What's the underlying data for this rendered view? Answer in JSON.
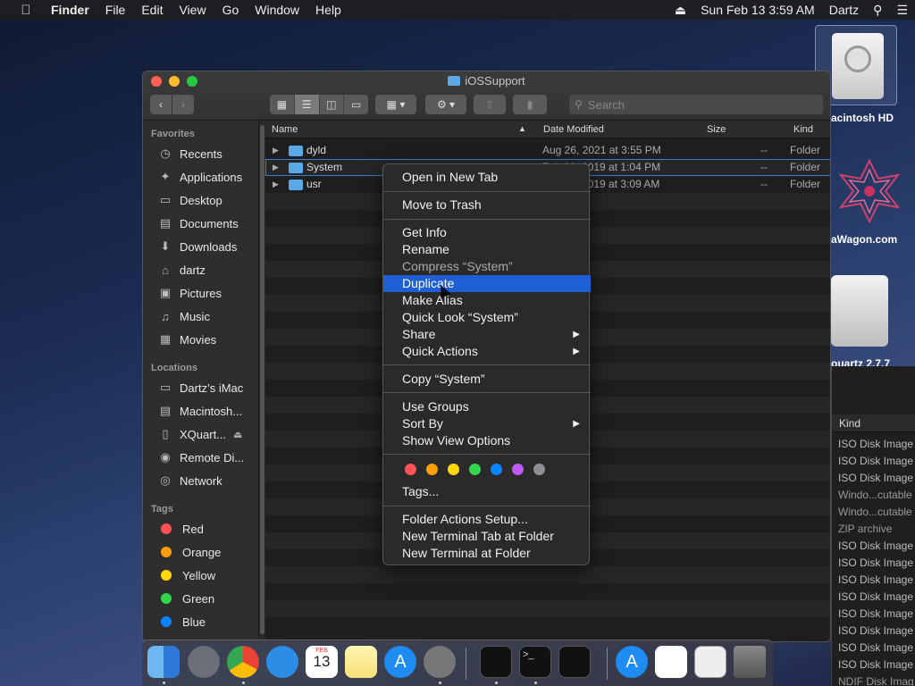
{
  "menubar": {
    "app": "Finder",
    "menus": [
      "File",
      "Edit",
      "View",
      "Go",
      "Window",
      "Help"
    ],
    "clock": "Sun Feb 13  3:59 AM",
    "user": "Dartz"
  },
  "desktop": {
    "hd_label": "acintosh HD",
    "wagon_label": "aWagon.com",
    "partial_label": "ouartz 2.7.7"
  },
  "window": {
    "title": "iOSSupport",
    "search_placeholder": "Search",
    "columns": {
      "name": "Name",
      "date": "Date Modified",
      "size": "Size",
      "kind": "Kind"
    },
    "rows": [
      {
        "name": "dyld",
        "date": "Aug 26, 2021 at 3:55 PM",
        "size": "--",
        "kind": "Folder"
      },
      {
        "name": "System",
        "date": "Feb 26, 2019 at 1:04 PM",
        "size": "--",
        "kind": "Folder"
      },
      {
        "name": "usr",
        "date": "Feb 26, 2019 at 3:09 AM",
        "size": "--",
        "kind": "Folder"
      }
    ]
  },
  "sidebar": {
    "favorites_header": "Favorites",
    "favorites": [
      "Recents",
      "Applications",
      "Desktop",
      "Documents",
      "Downloads",
      "dartz",
      "Pictures",
      "Music",
      "Movies"
    ],
    "locations_header": "Locations",
    "locations": [
      "Dartz’s iMac",
      "Macintosh...",
      "XQuart...",
      "Remote Di...",
      "Network"
    ],
    "tags_header": "Tags",
    "tags": [
      {
        "label": "Red",
        "color": "#ff5257"
      },
      {
        "label": "Orange",
        "color": "#ff9f0a"
      },
      {
        "label": "Yellow",
        "color": "#ffd60a"
      },
      {
        "label": "Green",
        "color": "#32d74b"
      },
      {
        "label": "Blue",
        "color": "#0a84ff"
      }
    ]
  },
  "context_menu": {
    "items": [
      "Open in New Tab",
      "Move to Trash",
      "Get Info",
      "Rename",
      "Compress “System”",
      "Duplicate",
      "Make Alias",
      "Quick Look “System”",
      "Share",
      "Quick Actions",
      "Copy “System”",
      "Use Groups",
      "Sort By",
      "Show View Options",
      "Tags...",
      "Folder Actions Setup...",
      "New Terminal Tab at Folder",
      "New Terminal at Folder"
    ],
    "highlighted": "Duplicate",
    "tag_colors": [
      "#ff5257",
      "#ff9f0a",
      "#ffd60a",
      "#32d74b",
      "#0a84ff",
      "#bf5af2",
      "#8e8e93"
    ]
  },
  "background_window": {
    "kind_header": "Kind",
    "kinds": [
      "ISO Disk Image",
      "ISO Disk Image",
      "ISO Disk Image",
      "Windo...cutable",
      "Windo...cutable",
      "ZIP archive",
      "ISO Disk Image",
      "ISO Disk Image",
      "ISO Disk Image",
      "ISO Disk Image",
      "ISO Disk Image",
      "ISO Disk Image",
      "ISO Disk Image",
      "ISO Disk Image",
      "NDIF Disk Imag"
    ]
  },
  "dock": {
    "calendar_month": "FEB",
    "calendar_day": "13"
  }
}
